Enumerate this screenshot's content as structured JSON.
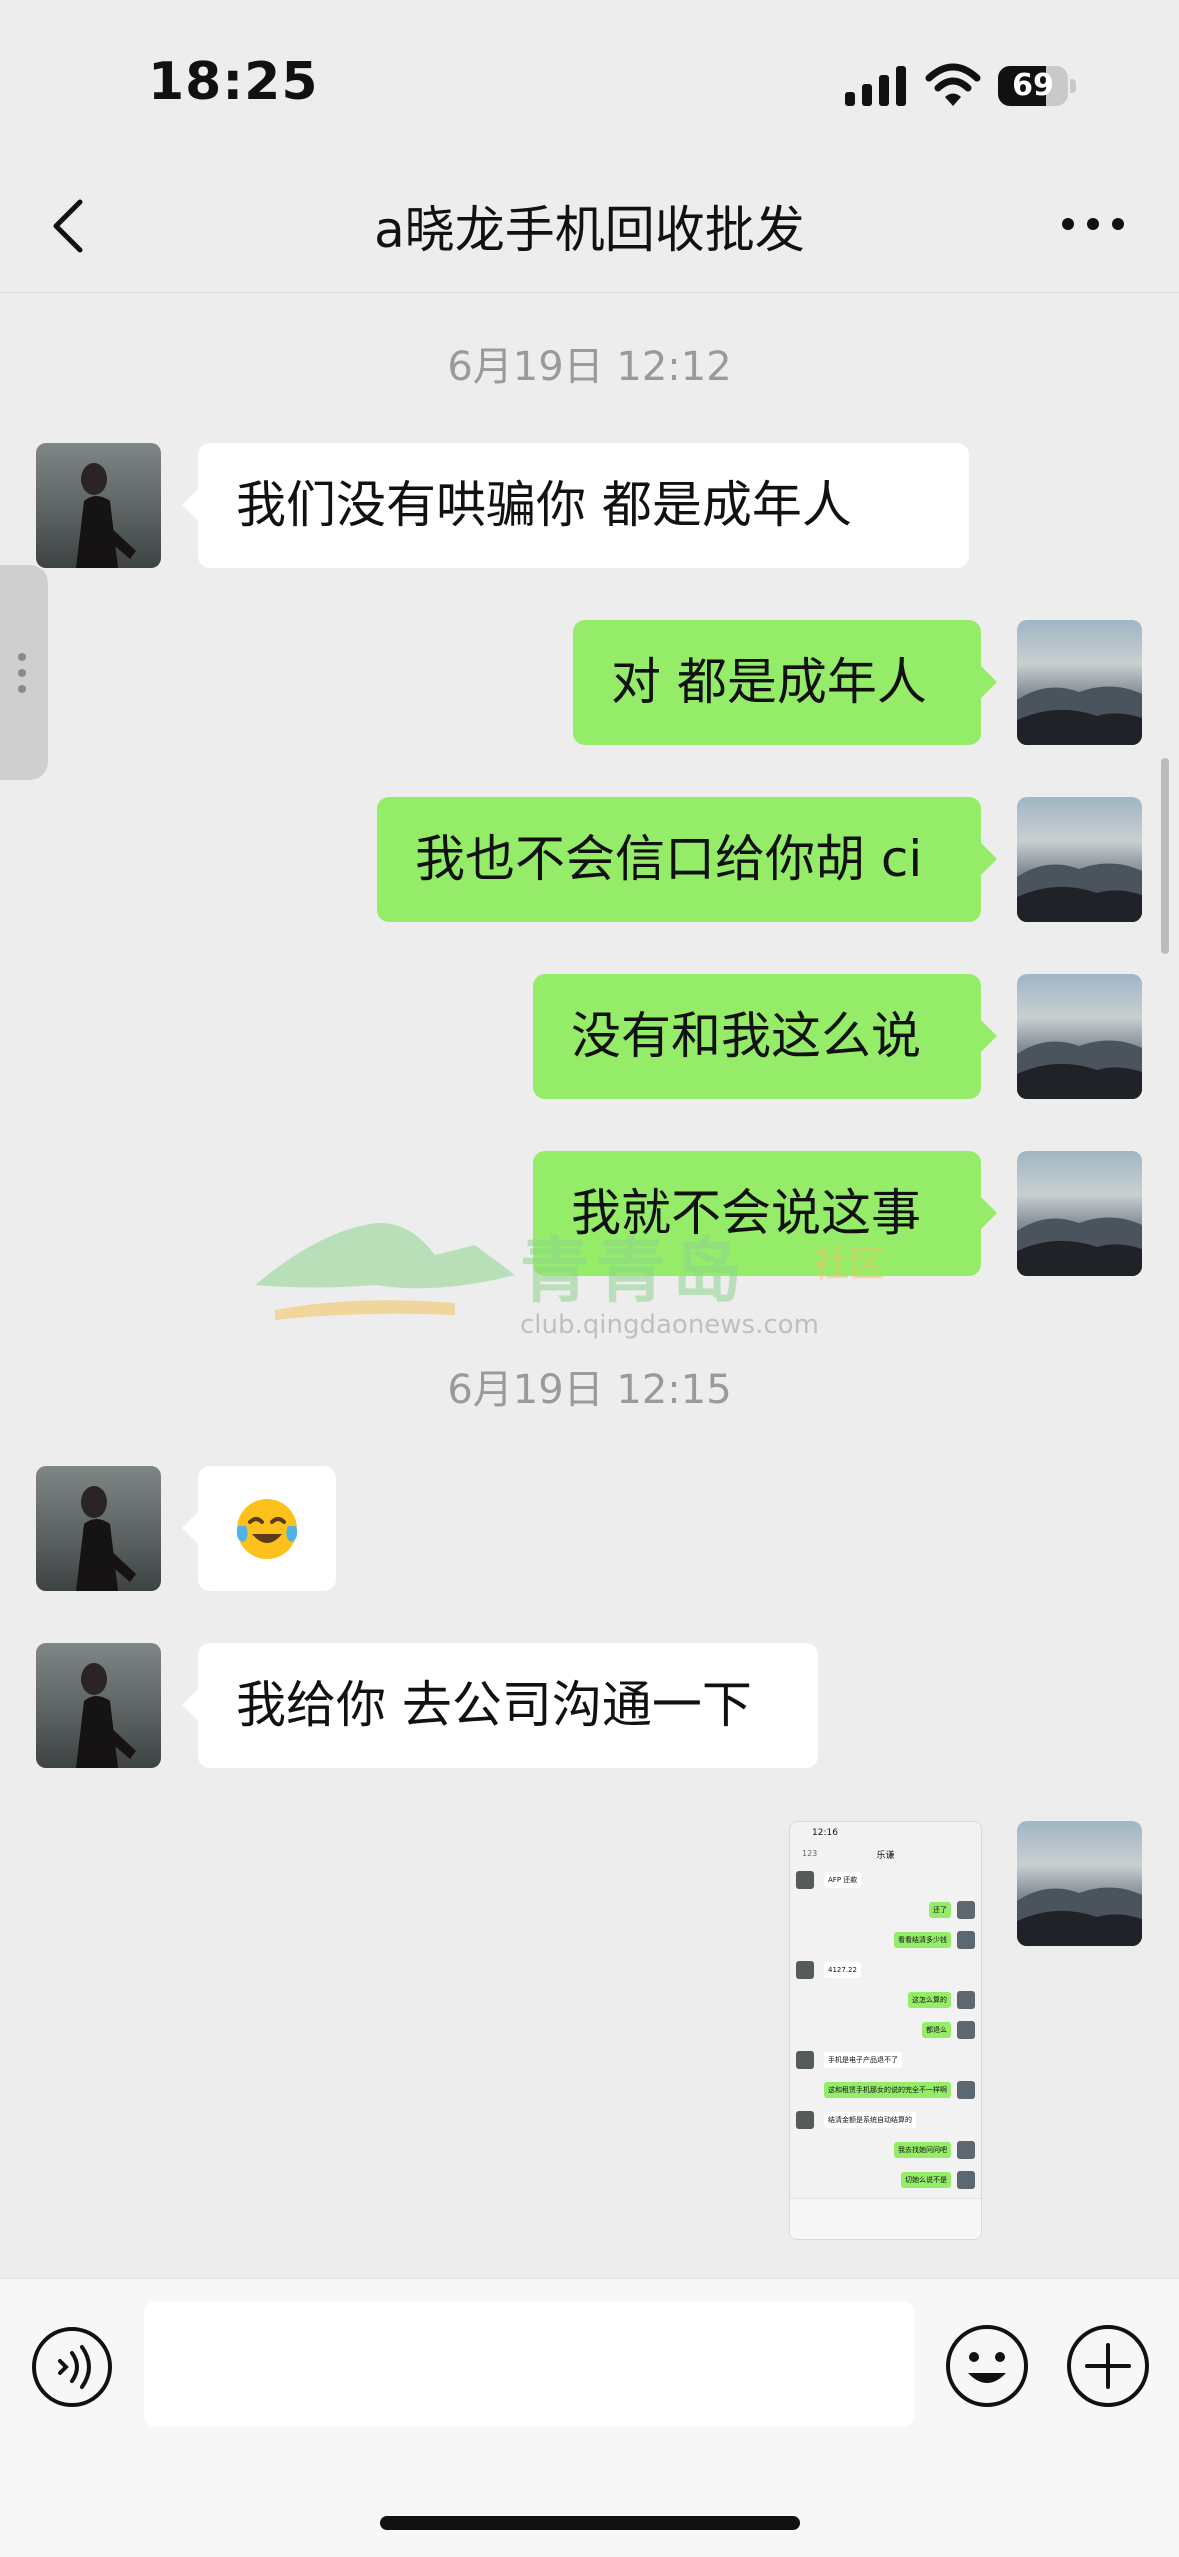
{
  "status_bar": {
    "time": "18:25",
    "battery_level": "69",
    "battery_fraction": 0.69,
    "icons": [
      "signal-icon",
      "wifi-icon",
      "battery-icon"
    ]
  },
  "nav": {
    "title": "a晓龙手机回收批发",
    "back_icon": "chevron-left-icon",
    "more_icon": "more-icon"
  },
  "messages": {
    "timestamp_1": "6月19日 12:12",
    "m1": "我们没有哄骗你   都是成年人",
    "m2": "对 都是成年人",
    "m3": "我也不会信口给你胡 ci",
    "m4": "没有和我这么说",
    "m5": "我就不会说这事",
    "timestamp_2": "6月19日 12:15",
    "m6_emoji": "😭",
    "m7": "我给你 去公司沟通一下"
  },
  "watermark": {
    "text": "青青岛",
    "sub": "社区",
    "url": "club.qingdaonews.com"
  },
  "screenshot_thumb": {
    "time": "12:16",
    "title": "乐谦",
    "badge": "123",
    "rows": [
      {
        "side": "in",
        "text": "AFP 还款"
      },
      {
        "side": "out",
        "text": "还了"
      },
      {
        "side": "out",
        "text": "看看结清多少钱"
      },
      {
        "side": "in",
        "text": "4127.22"
      },
      {
        "side": "out",
        "text": "这怎么算的"
      },
      {
        "side": "out",
        "text": "都退么"
      },
      {
        "side": "in",
        "text": "手机是电子产品退不了"
      },
      {
        "side": "out",
        "text": "这和租赁手机那女的说的完全不一样啊"
      },
      {
        "side": "in",
        "text": "结清金额是系统自动结算的"
      },
      {
        "side": "out",
        "text": "我去找她问问吧"
      },
      {
        "side": "out",
        "text": "切她么说不是"
      }
    ]
  },
  "input_bar": {
    "placeholder": "",
    "voice_icon": "voice-icon",
    "emoji_icon": "emoji-icon",
    "add_icon": "plus-icon"
  }
}
